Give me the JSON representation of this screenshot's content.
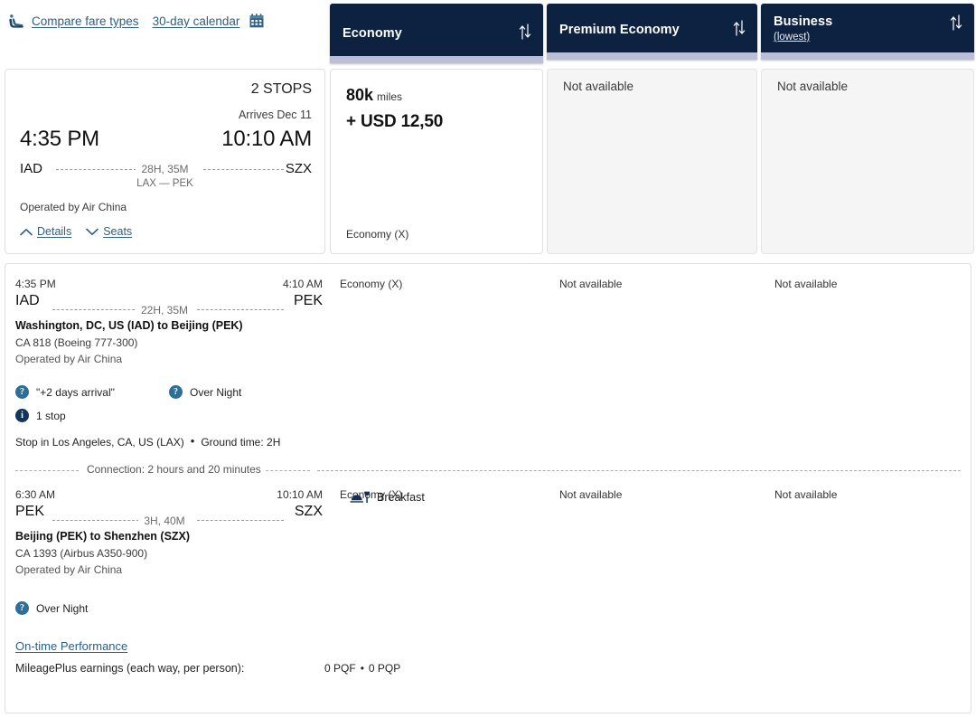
{
  "toolbar": {
    "seat_icon": "seat-icon",
    "compare_label": "Compare fare types",
    "calendar_label": "30-day calendar",
    "calendar_icon": "calendar-icon"
  },
  "fare_columns": [
    {
      "title": "Economy",
      "subtitle": "",
      "sort_icon": "sort-arrows-icon"
    },
    {
      "title": "Premium Economy",
      "subtitle": "",
      "sort_icon": "sort-arrows-icon"
    },
    {
      "title": "Business",
      "subtitle": "(lowest)",
      "sort_icon": "sort-arrows-icon"
    }
  ],
  "summary": {
    "stops": "2 STOPS",
    "arrives": "Arrives Dec 11",
    "depart_time": "4:35 PM",
    "arrive_time": "10:10 AM",
    "depart_code": "IAD",
    "arrive_code": "SZX",
    "duration": "28H, 35M",
    "via": "LAX — PEK",
    "operated_by": "Operated by Air China",
    "details_label": "Details",
    "seats_label": "Seats"
  },
  "fares": [
    {
      "available": true,
      "miles": "80k",
      "miles_unit": "miles",
      "cash": "+ USD 12,50",
      "fare_class": "Economy (X)"
    },
    {
      "available": false,
      "not_available": "Not available"
    },
    {
      "available": false,
      "not_available": "Not available"
    }
  ],
  "segments": [
    {
      "depart_time": "4:35 PM",
      "arrive_time": "4:10 AM",
      "depart_code": "IAD",
      "arrive_code": "PEK",
      "duration": "22H, 35M",
      "route": "Washington, DC, US (IAD) to Beijing (PEK)",
      "flight": "CA 818 (Boeing 777-300)",
      "operated_by": "Operated by Air China",
      "cabins": [
        "Economy (X)",
        "Not available",
        "Not available"
      ],
      "badges": [
        {
          "icon": "question-icon",
          "label": "\"+2 days arrival\""
        },
        {
          "icon": "question-icon",
          "label": "Over Night"
        },
        {
          "icon": "info-icon",
          "label": "1 stop"
        }
      ],
      "stop_text": "Stop in Los Angeles, CA, US (LAX)",
      "stop_sep": "•",
      "ground_time": "Ground time: 2H",
      "meal": null
    },
    {
      "depart_time": "6:30 AM",
      "arrive_time": "10:10 AM",
      "depart_code": "PEK",
      "arrive_code": "SZX",
      "duration": "3H, 40M",
      "route": "Beijing (PEK) to Shenzhen (SZX)",
      "flight": "CA 1393 (Airbus A350-900)",
      "operated_by": "Operated by Air China",
      "cabins": [
        "Economy (X)",
        "Not available",
        "Not available"
      ],
      "badges": [
        {
          "icon": "question-icon",
          "label": "Over Night"
        }
      ],
      "stop_text": "",
      "ground_time": "",
      "meal": {
        "icon": "meal-icon",
        "label": "Breakfast"
      }
    }
  ],
  "connection": {
    "label": "Connection: 2 hours and 20 minutes"
  },
  "footer": {
    "on_time_link": "On-time Performance",
    "mileage_label": "MileagePlus earnings (each way, per person):",
    "mileage_value_1": "0 PQF",
    "mileage_sep": "•",
    "mileage_value_2": "0 PQP"
  },
  "colors": {
    "header_navy": "#0d2240",
    "accent_bar": "#b9bedb",
    "link_blue": "#2c5f82",
    "badge_teal": "#2d6f96",
    "badge_navy": "#12355c"
  }
}
